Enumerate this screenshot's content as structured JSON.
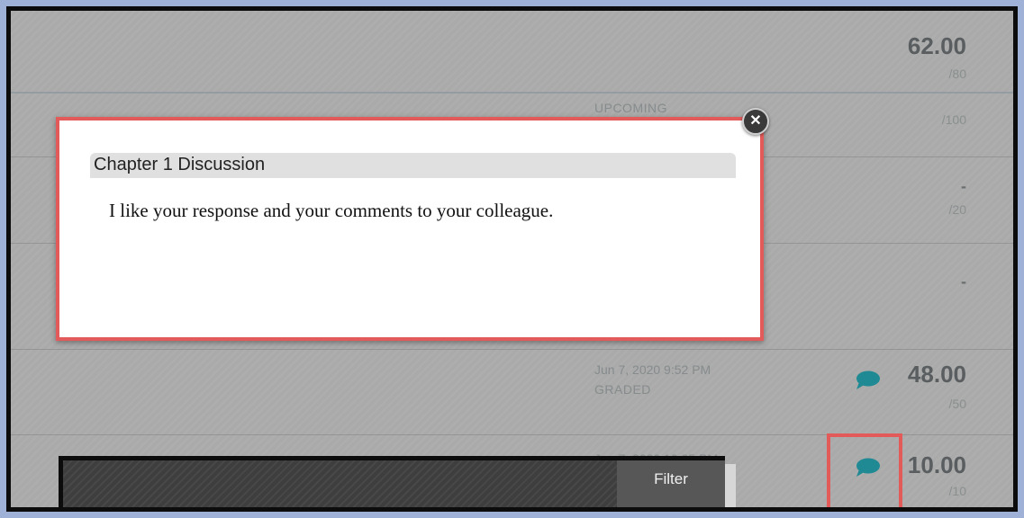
{
  "grades": {
    "row1": {
      "score": "62.00",
      "out_of": "/80"
    },
    "row2": {
      "status": "UPCOMING",
      "out_of": "/100"
    },
    "row3": {
      "score": "-",
      "out_of": "/20"
    },
    "row4": {
      "score": "-"
    },
    "row5": {
      "date": "Jun 7, 2020 9:52 PM",
      "status": "GRADED",
      "score": "48.00",
      "out_of": "/50",
      "comment_icon": "comment-bubble-icon"
    },
    "row6": {
      "date": "Jun 7, 2020 10:35 PM",
      "score": "10.00",
      "out_of": "/10",
      "comment_icon": "comment-bubble-icon"
    }
  },
  "feedback_popup": {
    "title": "Chapter 1 Discussion",
    "body": "I like your response and your comments to your colleague.",
    "close_icon": "close-icon",
    "close_symbol": "✕"
  },
  "filter_panel": {
    "button_label": "Filter"
  },
  "colors": {
    "highlight": "#e35a5a",
    "comment_icon": "#1f8a93"
  }
}
